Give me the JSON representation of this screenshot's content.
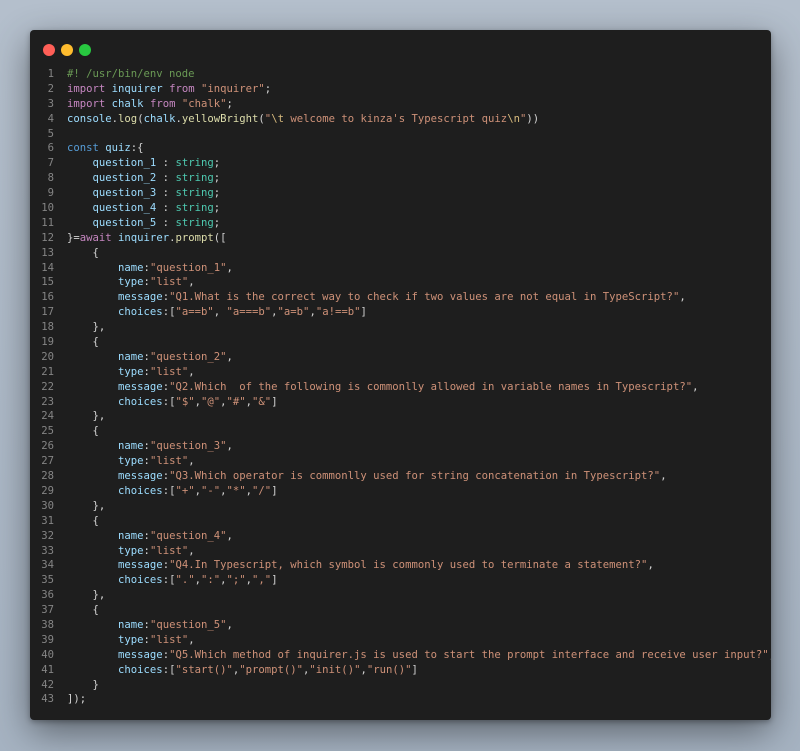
{
  "window": {
    "colors": {
      "close": "#ff5f57",
      "minimize": "#febc2e",
      "maximize": "#28c840",
      "background": "#1e1e1e"
    }
  },
  "editor": {
    "lines": [
      [
        {
          "t": "#! /usr/bin/env node",
          "c": "comment"
        }
      ],
      [
        {
          "t": "import",
          "c": "kw"
        },
        {
          "t": " inquirer ",
          "c": "var"
        },
        {
          "t": "from",
          "c": "kw"
        },
        {
          "t": " ",
          "c": "plain"
        },
        {
          "t": "\"inquirer\"",
          "c": "str"
        },
        {
          "t": ";",
          "c": "plain"
        }
      ],
      [
        {
          "t": "import",
          "c": "kw"
        },
        {
          "t": " chalk ",
          "c": "var"
        },
        {
          "t": "from",
          "c": "kw"
        },
        {
          "t": " ",
          "c": "plain"
        },
        {
          "t": "\"chalk\"",
          "c": "str"
        },
        {
          "t": ";",
          "c": "plain"
        }
      ],
      [
        {
          "t": "console",
          "c": "var"
        },
        {
          "t": ".",
          "c": "plain"
        },
        {
          "t": "log",
          "c": "fn"
        },
        {
          "t": "(",
          "c": "plain"
        },
        {
          "t": "chalk",
          "c": "var"
        },
        {
          "t": ".",
          "c": "plain"
        },
        {
          "t": "yellowBright",
          "c": "fn"
        },
        {
          "t": "(",
          "c": "plain"
        },
        {
          "t": "\"",
          "c": "str"
        },
        {
          "t": "\\t",
          "c": "esc"
        },
        {
          "t": " welcome to kinza's Typescript quiz",
          "c": "str"
        },
        {
          "t": "\\n",
          "c": "esc"
        },
        {
          "t": "\"",
          "c": "str"
        },
        {
          "t": "))",
          "c": "plain"
        }
      ],
      [],
      [
        {
          "t": "const",
          "c": "decl"
        },
        {
          "t": " ",
          "c": "plain"
        },
        {
          "t": "quiz",
          "c": "var"
        },
        {
          "t": ":{",
          "c": "plain"
        }
      ],
      [
        {
          "t": "    ",
          "c": "plain"
        },
        {
          "t": "question_1",
          "c": "prop"
        },
        {
          "t": " : ",
          "c": "plain"
        },
        {
          "t": "string",
          "c": "type"
        },
        {
          "t": ";",
          "c": "plain"
        }
      ],
      [
        {
          "t": "    ",
          "c": "plain"
        },
        {
          "t": "question_2",
          "c": "prop"
        },
        {
          "t": " : ",
          "c": "plain"
        },
        {
          "t": "string",
          "c": "type"
        },
        {
          "t": ";",
          "c": "plain"
        }
      ],
      [
        {
          "t": "    ",
          "c": "plain"
        },
        {
          "t": "question_3",
          "c": "prop"
        },
        {
          "t": " : ",
          "c": "plain"
        },
        {
          "t": "string",
          "c": "type"
        },
        {
          "t": ";",
          "c": "plain"
        }
      ],
      [
        {
          "t": "    ",
          "c": "plain"
        },
        {
          "t": "question_4",
          "c": "prop"
        },
        {
          "t": " : ",
          "c": "plain"
        },
        {
          "t": "string",
          "c": "type"
        },
        {
          "t": ";",
          "c": "plain"
        }
      ],
      [
        {
          "t": "    ",
          "c": "plain"
        },
        {
          "t": "question_5",
          "c": "prop"
        },
        {
          "t": " : ",
          "c": "plain"
        },
        {
          "t": "string",
          "c": "type"
        },
        {
          "t": ";",
          "c": "plain"
        }
      ],
      [
        {
          "t": "}=",
          "c": "plain"
        },
        {
          "t": "await",
          "c": "kw"
        },
        {
          "t": " ",
          "c": "plain"
        },
        {
          "t": "inquirer",
          "c": "var"
        },
        {
          "t": ".",
          "c": "plain"
        },
        {
          "t": "prompt",
          "c": "fn"
        },
        {
          "t": "([",
          "c": "plain"
        }
      ],
      [
        {
          "t": "    {",
          "c": "plain"
        }
      ],
      [
        {
          "t": "        ",
          "c": "plain"
        },
        {
          "t": "name",
          "c": "prop"
        },
        {
          "t": ":",
          "c": "plain"
        },
        {
          "t": "\"question_1\"",
          "c": "str"
        },
        {
          "t": ",",
          "c": "plain"
        }
      ],
      [
        {
          "t": "        ",
          "c": "plain"
        },
        {
          "t": "type",
          "c": "prop"
        },
        {
          "t": ":",
          "c": "plain"
        },
        {
          "t": "\"list\"",
          "c": "str"
        },
        {
          "t": ",",
          "c": "plain"
        }
      ],
      [
        {
          "t": "        ",
          "c": "plain"
        },
        {
          "t": "message",
          "c": "prop"
        },
        {
          "t": ":",
          "c": "plain"
        },
        {
          "t": "\"Q1.What is the correct way to check if two values are not equal in TypeScript?\"",
          "c": "str"
        },
        {
          "t": ",",
          "c": "plain"
        }
      ],
      [
        {
          "t": "        ",
          "c": "plain"
        },
        {
          "t": "choices",
          "c": "prop"
        },
        {
          "t": ":[",
          "c": "plain"
        },
        {
          "t": "\"a==b\"",
          "c": "str"
        },
        {
          "t": ", ",
          "c": "plain"
        },
        {
          "t": "\"a===b\"",
          "c": "str"
        },
        {
          "t": ",",
          "c": "plain"
        },
        {
          "t": "\"a=b\"",
          "c": "str"
        },
        {
          "t": ",",
          "c": "plain"
        },
        {
          "t": "\"a!==b\"",
          "c": "str"
        },
        {
          "t": "]",
          "c": "plain"
        }
      ],
      [
        {
          "t": "    },",
          "c": "plain"
        }
      ],
      [
        {
          "t": "    {",
          "c": "plain"
        }
      ],
      [
        {
          "t": "        ",
          "c": "plain"
        },
        {
          "t": "name",
          "c": "prop"
        },
        {
          "t": ":",
          "c": "plain"
        },
        {
          "t": "\"question_2\"",
          "c": "str"
        },
        {
          "t": ",",
          "c": "plain"
        }
      ],
      [
        {
          "t": "        ",
          "c": "plain"
        },
        {
          "t": "type",
          "c": "prop"
        },
        {
          "t": ":",
          "c": "plain"
        },
        {
          "t": "\"list\"",
          "c": "str"
        },
        {
          "t": ",",
          "c": "plain"
        }
      ],
      [
        {
          "t": "        ",
          "c": "plain"
        },
        {
          "t": "message",
          "c": "prop"
        },
        {
          "t": ":",
          "c": "plain"
        },
        {
          "t": "\"Q2.Which  of the following is commonlly allowed in variable names in Typescript?\"",
          "c": "str"
        },
        {
          "t": ",",
          "c": "plain"
        }
      ],
      [
        {
          "t": "        ",
          "c": "plain"
        },
        {
          "t": "choices",
          "c": "prop"
        },
        {
          "t": ":[",
          "c": "plain"
        },
        {
          "t": "\"$\"",
          "c": "str"
        },
        {
          "t": ",",
          "c": "plain"
        },
        {
          "t": "\"@\"",
          "c": "str"
        },
        {
          "t": ",",
          "c": "plain"
        },
        {
          "t": "\"#\"",
          "c": "str"
        },
        {
          "t": ",",
          "c": "plain"
        },
        {
          "t": "\"&\"",
          "c": "str"
        },
        {
          "t": "]",
          "c": "plain"
        }
      ],
      [
        {
          "t": "    },",
          "c": "plain"
        }
      ],
      [
        {
          "t": "    {",
          "c": "plain"
        }
      ],
      [
        {
          "t": "        ",
          "c": "plain"
        },
        {
          "t": "name",
          "c": "prop"
        },
        {
          "t": ":",
          "c": "plain"
        },
        {
          "t": "\"question_3\"",
          "c": "str"
        },
        {
          "t": ",",
          "c": "plain"
        }
      ],
      [
        {
          "t": "        ",
          "c": "plain"
        },
        {
          "t": "type",
          "c": "prop"
        },
        {
          "t": ":",
          "c": "plain"
        },
        {
          "t": "\"list\"",
          "c": "str"
        },
        {
          "t": ",",
          "c": "plain"
        }
      ],
      [
        {
          "t": "        ",
          "c": "plain"
        },
        {
          "t": "message",
          "c": "prop"
        },
        {
          "t": ":",
          "c": "plain"
        },
        {
          "t": "\"Q3.Which operator is commonlly used for string concatenation in Typescript?\"",
          "c": "str"
        },
        {
          "t": ",",
          "c": "plain"
        }
      ],
      [
        {
          "t": "        ",
          "c": "plain"
        },
        {
          "t": "choices",
          "c": "prop"
        },
        {
          "t": ":[",
          "c": "plain"
        },
        {
          "t": "\"+\"",
          "c": "str"
        },
        {
          "t": ",",
          "c": "plain"
        },
        {
          "t": "\"-\"",
          "c": "str"
        },
        {
          "t": ",",
          "c": "plain"
        },
        {
          "t": "\"*\"",
          "c": "str"
        },
        {
          "t": ",",
          "c": "plain"
        },
        {
          "t": "\"/\"",
          "c": "str"
        },
        {
          "t": "]",
          "c": "plain"
        }
      ],
      [
        {
          "t": "    },",
          "c": "plain"
        }
      ],
      [
        {
          "t": "    {",
          "c": "plain"
        }
      ],
      [
        {
          "t": "        ",
          "c": "plain"
        },
        {
          "t": "name",
          "c": "prop"
        },
        {
          "t": ":",
          "c": "plain"
        },
        {
          "t": "\"question_4\"",
          "c": "str"
        },
        {
          "t": ",",
          "c": "plain"
        }
      ],
      [
        {
          "t": "        ",
          "c": "plain"
        },
        {
          "t": "type",
          "c": "prop"
        },
        {
          "t": ":",
          "c": "plain"
        },
        {
          "t": "\"list\"",
          "c": "str"
        },
        {
          "t": ",",
          "c": "plain"
        }
      ],
      [
        {
          "t": "        ",
          "c": "plain"
        },
        {
          "t": "message",
          "c": "prop"
        },
        {
          "t": ":",
          "c": "plain"
        },
        {
          "t": "\"Q4.In Typescript, which symbol is commonly used to terminate a statement?\"",
          "c": "str"
        },
        {
          "t": ",",
          "c": "plain"
        }
      ],
      [
        {
          "t": "        ",
          "c": "plain"
        },
        {
          "t": "choices",
          "c": "prop"
        },
        {
          "t": ":[",
          "c": "plain"
        },
        {
          "t": "\".\"",
          "c": "str"
        },
        {
          "t": ",",
          "c": "plain"
        },
        {
          "t": "\":\"",
          "c": "str"
        },
        {
          "t": ",",
          "c": "plain"
        },
        {
          "t": "\";\"",
          "c": "str"
        },
        {
          "t": ",",
          "c": "plain"
        },
        {
          "t": "\",\"",
          "c": "str"
        },
        {
          "t": "]",
          "c": "plain"
        }
      ],
      [
        {
          "t": "    },",
          "c": "plain"
        }
      ],
      [
        {
          "t": "    {",
          "c": "plain"
        }
      ],
      [
        {
          "t": "        ",
          "c": "plain"
        },
        {
          "t": "name",
          "c": "prop"
        },
        {
          "t": ":",
          "c": "plain"
        },
        {
          "t": "\"question_5\"",
          "c": "str"
        },
        {
          "t": ",",
          "c": "plain"
        }
      ],
      [
        {
          "t": "        ",
          "c": "plain"
        },
        {
          "t": "type",
          "c": "prop"
        },
        {
          "t": ":",
          "c": "plain"
        },
        {
          "t": "\"list\"",
          "c": "str"
        },
        {
          "t": ",",
          "c": "plain"
        }
      ],
      [
        {
          "t": "        ",
          "c": "plain"
        },
        {
          "t": "message",
          "c": "prop"
        },
        {
          "t": ":",
          "c": "plain"
        },
        {
          "t": "\"Q5.Which method of inquirer.js is used to start the prompt interface and receive user input?\"",
          "c": "str"
        },
        {
          "t": ",",
          "c": "plain"
        }
      ],
      [
        {
          "t": "        ",
          "c": "plain"
        },
        {
          "t": "choices",
          "c": "prop"
        },
        {
          "t": ":[",
          "c": "plain"
        },
        {
          "t": "\"start()\"",
          "c": "str"
        },
        {
          "t": ",",
          "c": "plain"
        },
        {
          "t": "\"prompt()\"",
          "c": "str"
        },
        {
          "t": ",",
          "c": "plain"
        },
        {
          "t": "\"init()\"",
          "c": "str"
        },
        {
          "t": ",",
          "c": "plain"
        },
        {
          "t": "\"run()\"",
          "c": "str"
        },
        {
          "t": "]",
          "c": "plain"
        }
      ],
      [
        {
          "t": "    }",
          "c": "plain"
        }
      ],
      [
        {
          "t": "]);",
          "c": "plain"
        }
      ]
    ]
  }
}
